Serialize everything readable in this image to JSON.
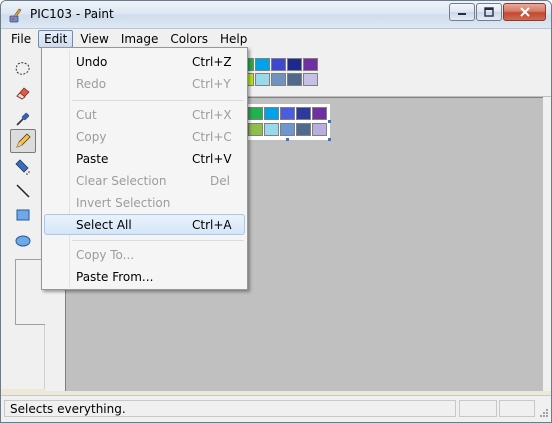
{
  "window": {
    "title": "PIC103 - Paint"
  },
  "menubar": {
    "items": [
      "File",
      "Edit",
      "View",
      "Image",
      "Colors",
      "Help"
    ],
    "open_item": "Edit"
  },
  "edit_menu": {
    "items": [
      {
        "label": "Undo",
        "shortcut": "Ctrl+Z",
        "enabled": true
      },
      {
        "label": "Redo",
        "shortcut": "Ctrl+Y",
        "enabled": false
      },
      {
        "label": "Cut",
        "shortcut": "Ctrl+X",
        "enabled": false
      },
      {
        "label": "Copy",
        "shortcut": "Ctrl+C",
        "enabled": false
      },
      {
        "label": "Paste",
        "shortcut": "Ctrl+V",
        "enabled": true
      },
      {
        "label": "Clear Selection",
        "shortcut": "Del",
        "enabled": false
      },
      {
        "label": "Invert Selection",
        "shortcut": "",
        "enabled": false
      },
      {
        "label": "Select All",
        "shortcut": "Ctrl+A",
        "enabled": true,
        "highlighted": true
      },
      {
        "label": "Copy To...",
        "shortcut": "",
        "enabled": false
      },
      {
        "label": "Paste From...",
        "shortcut": "",
        "enabled": true
      }
    ]
  },
  "palette": {
    "row1": [
      "#22b14c",
      "#00a2e8",
      "#3f48cc",
      "#1d2a8c",
      "#7030a0"
    ],
    "row2": [
      "#b5e61d",
      "#99d9ea",
      "#7092be",
      "#4f6a8c",
      "#c8bfe7"
    ]
  },
  "image_palette": {
    "row1": [
      "#22b14c",
      "#00a2e8",
      "#4a5de0",
      "#2b3a9c",
      "#7030a0"
    ],
    "row2": [
      "#8fbf4a",
      "#99d9ea",
      "#6e96d0",
      "#4f6a8c",
      "#b9aee0"
    ]
  },
  "toolbox": {
    "tools": [
      "free-form-select-icon",
      "eraser-icon",
      "color-picker-icon",
      "pencil-icon",
      "airbrush-icon",
      "line-icon",
      "rectangle-icon",
      "ellipse-icon"
    ],
    "active_tool": "pencil-icon"
  },
  "status": {
    "text": "Selects everything."
  }
}
